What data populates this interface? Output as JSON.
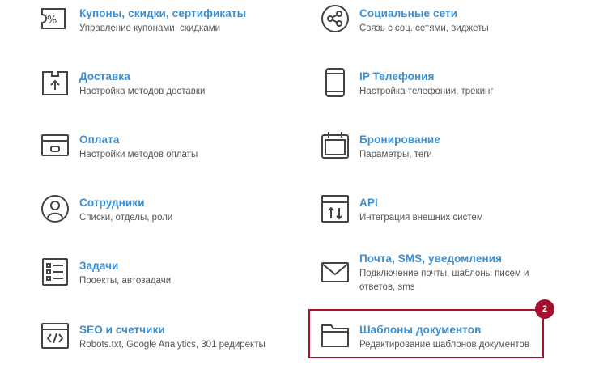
{
  "items": [
    {
      "title": "Купоны, скидки, сертификаты",
      "desc": "Управление купонами, скидками",
      "icon": "coupon-icon"
    },
    {
      "title": "Социальные сети",
      "desc": "Связь с соц. сетями, виджеты",
      "icon": "share-icon"
    },
    {
      "title": "Доставка",
      "desc": "Настройка методов доставки",
      "icon": "delivery-box-icon"
    },
    {
      "title": "IP Телефония",
      "desc": "Настройка телефонии, трекинг",
      "icon": "phone-icon"
    },
    {
      "title": "Оплата",
      "desc": "Настройки методов оплаты",
      "icon": "card-icon"
    },
    {
      "title": "Бронирование",
      "desc": "Параметры, теги",
      "icon": "calendar-icon"
    },
    {
      "title": "Сотрудники",
      "desc": "Списки, отделы, роли",
      "icon": "user-icon"
    },
    {
      "title": "API",
      "desc": "Интеграция внешних систем",
      "icon": "api-icon"
    },
    {
      "title": "Задачи",
      "desc": "Проекты, автозадачи",
      "icon": "tasks-icon"
    },
    {
      "title": "Почта, SMS, уведомления",
      "desc": "Подключение почты, шаблоны писем и ответов, sms",
      "icon": "mail-icon"
    },
    {
      "title": "SEO и счетчики",
      "desc": "Robots.txt, Google Analytics, 301 редиректы",
      "icon": "code-icon"
    },
    {
      "title": "Шаблоны документов",
      "desc": "Редактирование шаблонов документов",
      "icon": "folder-icon"
    }
  ],
  "highlight_badge": "2",
  "colors": {
    "title": "#3d8fd1",
    "icon": "#444444",
    "highlight": "#a5102e"
  }
}
